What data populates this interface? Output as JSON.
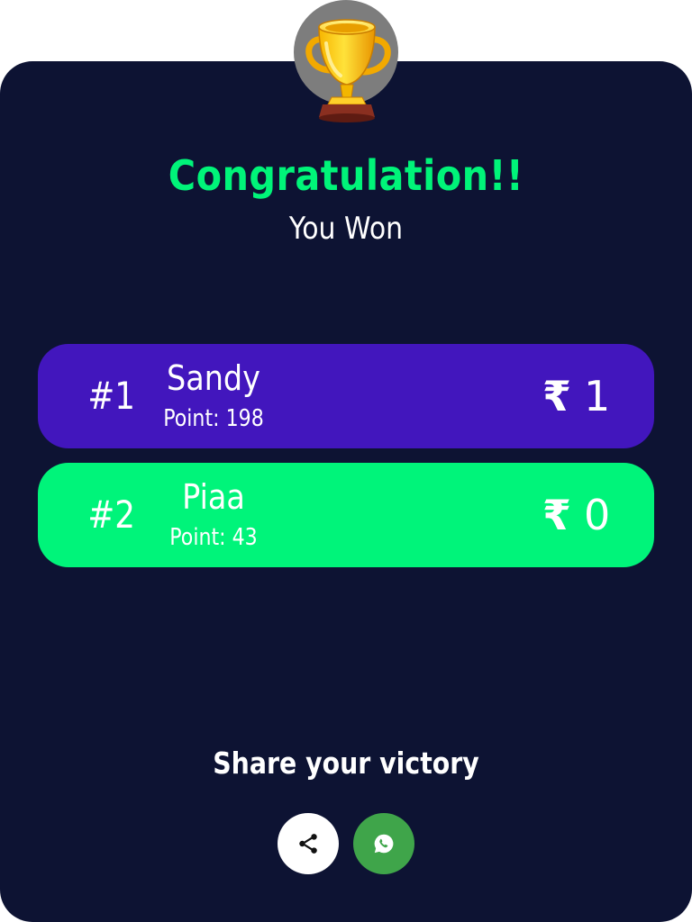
{
  "result": {
    "title": "Congratulation!!",
    "subtitle": "You Won"
  },
  "leaderboard": [
    {
      "rank": "#1",
      "name": "Sandy",
      "points": "Point: 198",
      "currency": "₹",
      "prize": "1",
      "color": "#4216bd"
    },
    {
      "rank": "#2",
      "name": "Piaa",
      "points": "Point: 43",
      "currency": "₹",
      "prize": "0",
      "color": "#00f47a"
    }
  ],
  "share": {
    "title": "Share your victory",
    "buttons": [
      {
        "icon": "share-icon"
      },
      {
        "icon": "whatsapp-icon"
      }
    ]
  },
  "colors": {
    "background": "#0d1333",
    "accent": "#00f479",
    "first_place": "#4216bd",
    "second_place": "#00f47a",
    "whatsapp": "#3fa54a"
  }
}
